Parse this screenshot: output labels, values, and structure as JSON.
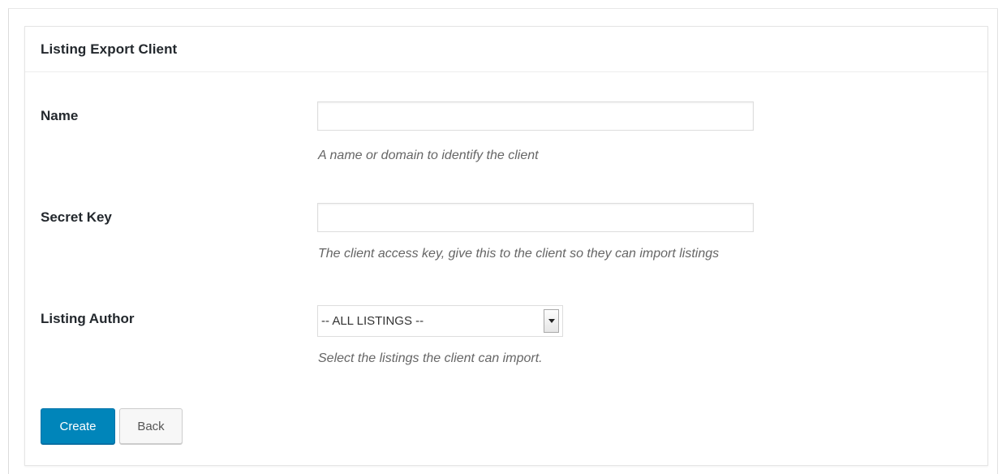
{
  "panel": {
    "title": "Listing Export Client"
  },
  "fields": {
    "name": {
      "label": "Name",
      "value": "",
      "placeholder": "",
      "hint": "A name or domain to identify the client"
    },
    "secret_key": {
      "label": "Secret Key",
      "value": "",
      "placeholder": "",
      "hint": "The client access key, give this to the client so they can import listings"
    },
    "listing_author": {
      "label": "Listing Author",
      "selected": "-- ALL LISTINGS --",
      "hint": "Select the listings the client can import."
    }
  },
  "actions": {
    "create_label": "Create",
    "back_label": "Back"
  },
  "colors": {
    "primary": "#0085ba",
    "hint_text": "#666666"
  },
  "icons": {
    "select_arrow": "chevron-down-icon"
  }
}
